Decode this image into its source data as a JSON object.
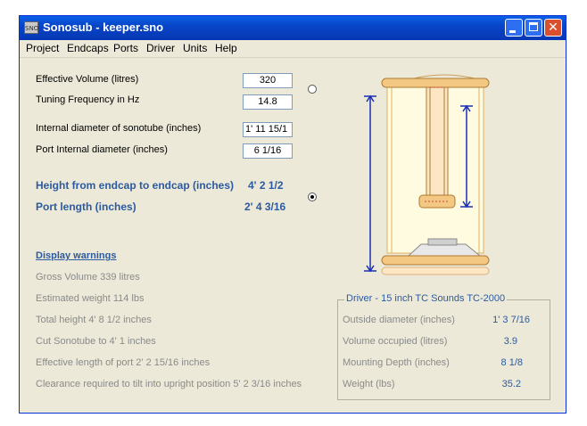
{
  "window": {
    "title": "Sonosub - keeper.sno",
    "icon": "sno-app-icon",
    "icon_text": "SNO"
  },
  "menu": [
    "Project",
    "Endcaps",
    "Ports",
    "Driver",
    "Units",
    "Help"
  ],
  "inputs": {
    "effective_volume": {
      "label": "Effective Volume (litres)",
      "value": "320"
    },
    "tuning_frequency": {
      "label": "Tuning Frequency in Hz",
      "value": "14.8"
    },
    "internal_diameter": {
      "label": "Internal diameter of sonotube (inches)",
      "value": "1' 11 15/1"
    },
    "port_diameter": {
      "label": "Port Internal diameter (inches)",
      "value": "6 1/16"
    }
  },
  "results": {
    "height": {
      "label": "Height from endcap to endcap (inches)",
      "value": "4' 2 1/2"
    },
    "port_length": {
      "label": "Port length (inches)",
      "value": "2' 4 3/16"
    }
  },
  "radios": {
    "volume_freq_selected": false,
    "height_port_selected": true
  },
  "warnings": {
    "link": "Display warnings",
    "lines": [
      "Gross Volume  339 litres",
      "Estimated weight  114 lbs",
      "Total height 4' 8 1/2 inches",
      "Cut Sonotube to  4' 1 inches",
      "Effective length of port 2' 2 15/16 inches",
      "Clearance required to tilt into upright position 5' 2 3/16 inches"
    ]
  },
  "driver": {
    "title": "Driver - 15 inch TC Sounds TC-2000",
    "rows": [
      {
        "label": "Outside diameter (inches)",
        "value": "1' 3 7/16"
      },
      {
        "label": "Volume occupied (litres)",
        "value": "3.9"
      },
      {
        "label": "Mounting Depth (inches)",
        "value": "8 1/8"
      },
      {
        "label": "Weight (lbs)",
        "value": "35.2"
      }
    ]
  },
  "colors": {
    "accent_text": "#2c5aa0",
    "diagram_arrow": "#1a2fb5",
    "endcap_fill": "#f2c882",
    "tube_fill": "#fffbe0",
    "port_fill": "#fde6c4",
    "port_line": "#d04040"
  }
}
